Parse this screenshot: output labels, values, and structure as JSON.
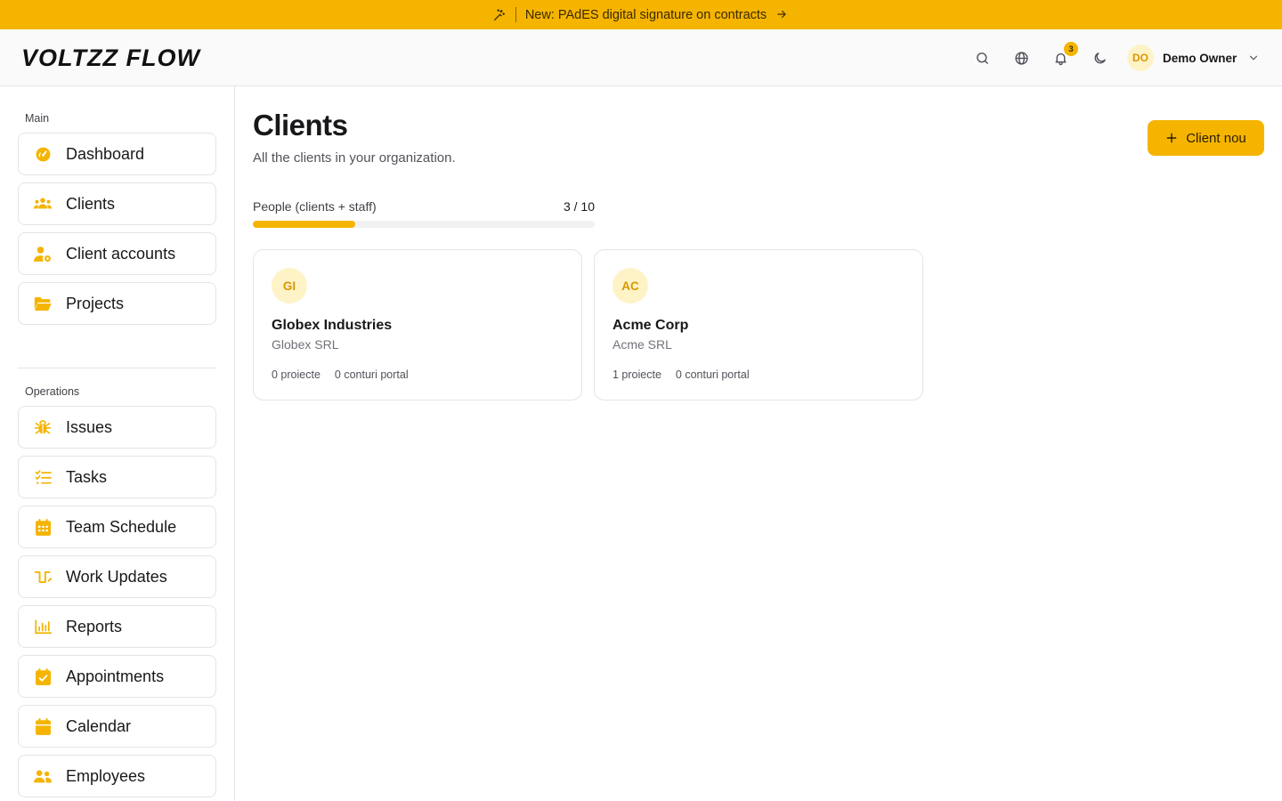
{
  "banner": {
    "text": "New: PAdES digital signature on contracts"
  },
  "header": {
    "logo_text": "VOLTZZ FLOW",
    "notifications_count": "3",
    "user_initials": "DO",
    "user_name": "Demo Owner"
  },
  "sidebar": {
    "sections": [
      {
        "label": "Main",
        "items": [
          {
            "label": "Dashboard",
            "icon": "gauge-icon"
          },
          {
            "label": "Clients",
            "icon": "users-icon"
          },
          {
            "label": "Client accounts",
            "icon": "user-cog-icon"
          },
          {
            "label": "Projects",
            "icon": "folder-open-icon"
          }
        ]
      },
      {
        "label": "Operations",
        "items": [
          {
            "label": "Issues",
            "icon": "bug-icon"
          },
          {
            "label": "Tasks",
            "icon": "list-checks-icon"
          },
          {
            "label": "Team Schedule",
            "icon": "calendar-grid-icon"
          },
          {
            "label": "Work Updates",
            "icon": "pulse-icon"
          },
          {
            "label": "Reports",
            "icon": "bar-chart-icon"
          },
          {
            "label": "Appointments",
            "icon": "calendar-check-icon"
          },
          {
            "label": "Calendar",
            "icon": "calendar-icon"
          },
          {
            "label": "Employees",
            "icon": "people-icon"
          }
        ]
      }
    ]
  },
  "main": {
    "title": "Clients",
    "subtitle": "All the clients in your organization.",
    "new_client_label": "Client nou",
    "quota": {
      "label": "People (clients + staff)",
      "value_text": "3 / 10",
      "used": 3,
      "total": 10
    },
    "clients": [
      {
        "initials": "GI",
        "name": "Globex Industries",
        "legal_name": "Globex SRL",
        "projects": "0 proiecte",
        "portal_accounts": "0 conturi portal"
      },
      {
        "initials": "AC",
        "name": "Acme Corp",
        "legal_name": "Acme SRL",
        "projects": "1 proiecte",
        "portal_accounts": "0 conturi portal"
      }
    ]
  },
  "colors": {
    "accent": "#f5b400",
    "avatar_bg": "#fef3c7",
    "avatar_fg": "#d99700",
    "border": "#e4e4e7"
  }
}
